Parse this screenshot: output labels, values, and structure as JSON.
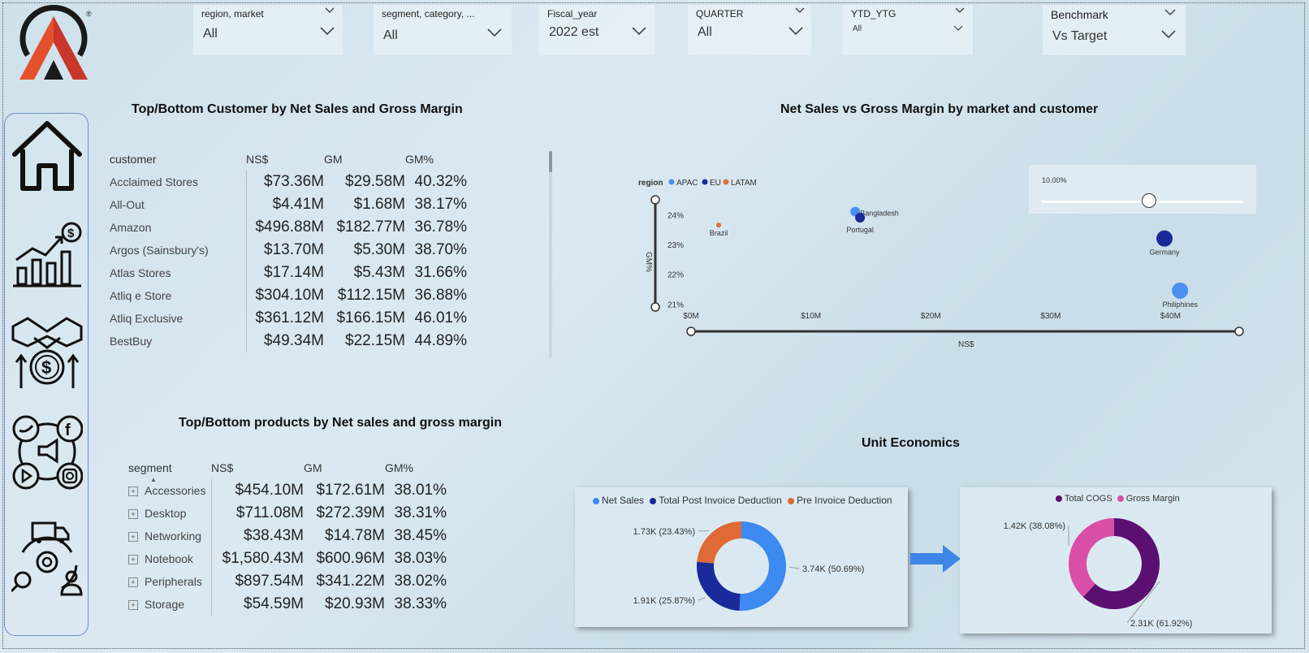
{
  "colors": {
    "apac": "#4a90f0",
    "eu": "#1a2a9a",
    "latam": "#e0703a",
    "net_sales": "#3d8af0",
    "post_invoice": "#1a2a9a",
    "pre_invoice": "#e06a35",
    "cogs": "#5b0f70",
    "gross_margin": "#d94fa8"
  },
  "slicers": [
    {
      "title": "region, market",
      "value": "All"
    },
    {
      "title": "segment, category, ...",
      "value": "All"
    },
    {
      "title": "Fiscal_year",
      "value": "2022 est"
    },
    {
      "title": "QUARTER",
      "value": "All"
    },
    {
      "title": "YTD_YTG",
      "value": "All"
    },
    {
      "title": "Benchmark",
      "value": "Vs Target"
    }
  ],
  "customer_table": {
    "title": "Top/Bottom Customer by Net Sales and Gross Margin",
    "headers": [
      "customer",
      "NS$",
      "GM",
      "GM%"
    ],
    "rows": [
      [
        "Acclaimed Stores",
        "$73.36M",
        "$29.58M",
        "40.32%"
      ],
      [
        "All-Out",
        "$4.41M",
        "$1.68M",
        "38.17%"
      ],
      [
        "Amazon",
        "$496.88M",
        "$182.77M",
        "36.78%"
      ],
      [
        "Argos (Sainsbury's)",
        "$13.70M",
        "$5.30M",
        "38.70%"
      ],
      [
        "Atlas Stores",
        "$17.14M",
        "$5.43M",
        "31.66%"
      ],
      [
        "Atliq e Store",
        "$304.10M",
        "$112.15M",
        "36.88%"
      ],
      [
        "Atliq Exclusive",
        "$361.12M",
        "$166.15M",
        "46.01%"
      ],
      [
        "BestBuy",
        "$49.34M",
        "$22.15M",
        "44.89%"
      ]
    ]
  },
  "product_table": {
    "title": "Top/Bottom products by Net sales and gross margin",
    "headers": [
      "segment",
      "NS$",
      "GM",
      "GM%"
    ],
    "rows": [
      [
        "Accessories",
        "$454.10M",
        "$172.61M",
        "38.01%"
      ],
      [
        "Desktop",
        "$711.08M",
        "$272.39M",
        "38.31%"
      ],
      [
        "Networking",
        "$38.43M",
        "$14.78M",
        "38.45%"
      ],
      [
        "Notebook",
        "$1,580.43M",
        "$600.96M",
        "38.03%"
      ],
      [
        "Peripherals",
        "$897.54M",
        "$341.22M",
        "38.02%"
      ],
      [
        "Storage",
        "$54.59M",
        "$20.93M",
        "38.33%"
      ]
    ]
  },
  "scatter": {
    "title": "Net Sales vs Gross Margin  by market and customer",
    "legend_title": "region",
    "legend": [
      "APAC",
      "EU",
      "LATAM"
    ],
    "xlabel": "NS$",
    "ylabel": "GM%",
    "slider_label": "10.00%"
  },
  "unit_economics": {
    "title": "Unit Economics",
    "donut1_legend": [
      "Net Sales",
      "Total Post Invoice Deduction",
      "Pre Invoice Deduction"
    ],
    "donut2_legend": [
      "Total COGS",
      "Gross Margin"
    ]
  },
  "chart_data": [
    {
      "type": "scatter",
      "title": "Net Sales vs Gross Margin  by market and customer",
      "xlabel": "NS$",
      "ylabel": "GM%",
      "x_ticks": [
        "$0M",
        "$10M",
        "$20M",
        "$30M",
        "$40M"
      ],
      "y_ticks": [
        "24%",
        "23%",
        "22%",
        "21%"
      ],
      "xlim": [
        0,
        46
      ],
      "ylim": [
        20.9,
        24.5
      ],
      "points": [
        {
          "label": "Bangladesh",
          "region": "APAC",
          "x": 13.7,
          "y": 24.1,
          "size": 6
        },
        {
          "label": "Portugal",
          "region": "EU",
          "x": 14.1,
          "y": 23.9,
          "size": 6
        },
        {
          "label": "Brazil",
          "region": "LATAM",
          "x": 2.3,
          "y": 23.65,
          "size": 3
        },
        {
          "label": "Germany",
          "region": "EU",
          "x": 39.5,
          "y": 23.2,
          "size": 10
        },
        {
          "label": "Philiphines",
          "region": "APAC",
          "x": 40.8,
          "y": 21.45,
          "size": 10
        }
      ]
    },
    {
      "type": "pie",
      "labels": [
        "Net Sales",
        "Total Post Invoice Deduction",
        "Pre Invoice Deduction"
      ],
      "values": [
        3.74,
        1.91,
        1.73
      ],
      "data_labels": [
        "3.74K (50.69%)",
        "1.91K (25.87%)",
        "1.73K (23.43%)"
      ]
    },
    {
      "type": "pie",
      "labels": [
        "Total COGS",
        "Gross Margin"
      ],
      "values": [
        2.31,
        1.42
      ],
      "data_labels": [
        "2.31K (61.92%)",
        "1.42K (38.08%)"
      ]
    }
  ]
}
